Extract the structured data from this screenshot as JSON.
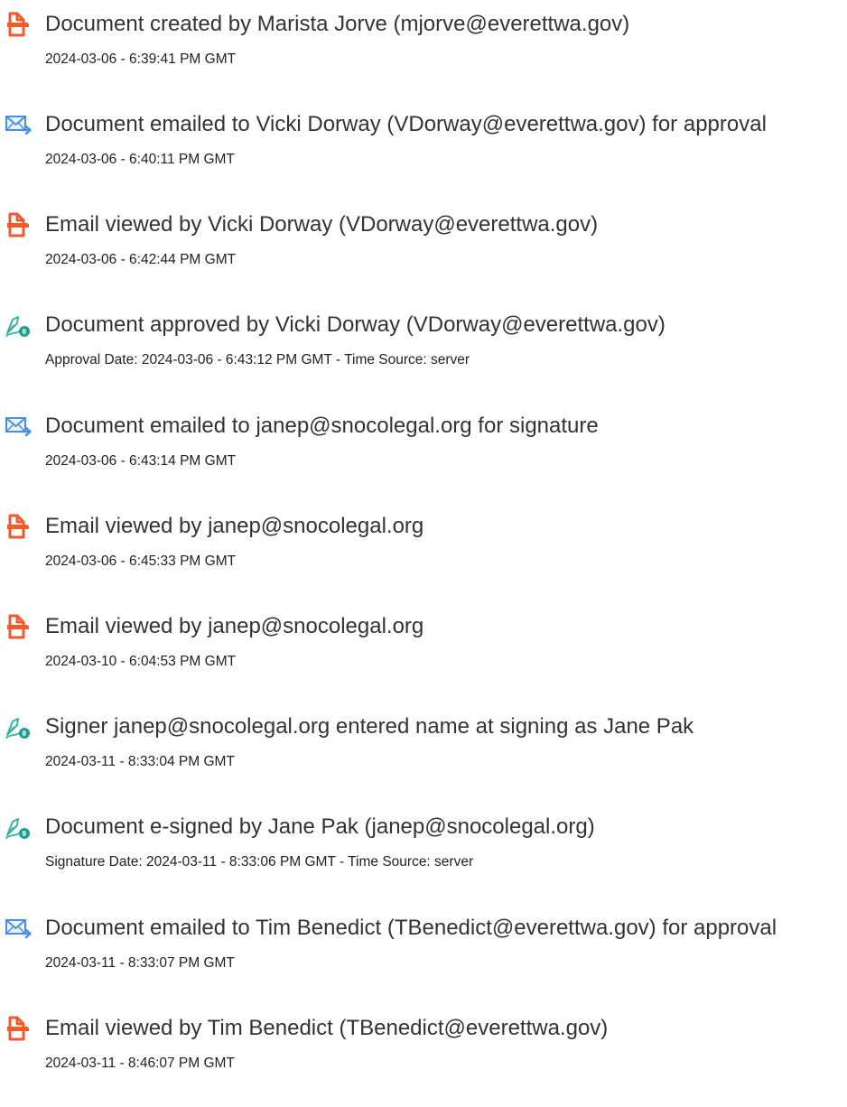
{
  "colors": {
    "created_icon": "#f15a2b",
    "email_icon": "#4a90e2",
    "sign_icon_pen": "#3bb3a4",
    "sign_icon_badge": "#1aa08f",
    "text": "#333333"
  },
  "events": [
    {
      "icon": "document-created-icon",
      "description": "Document created by Marista Jorve (mjorve@everettwa.gov)",
      "timestamp": "2024-03-06 - 6:39:41 PM GMT"
    },
    {
      "icon": "email-sent-icon",
      "description": "Document emailed to Vicki Dorway (VDorway@everettwa.gov) for approval",
      "timestamp": "2024-03-06 - 6:40:11 PM GMT"
    },
    {
      "icon": "document-viewed-icon",
      "description": "Email viewed by Vicki Dorway (VDorway@everettwa.gov)",
      "timestamp": "2024-03-06 - 6:42:44 PM GMT"
    },
    {
      "icon": "e-sign-icon",
      "description": "Document approved by Vicki Dorway (VDorway@everettwa.gov)",
      "timestamp": "Approval Date: 2024-03-06 - 6:43:12 PM GMT - Time Source: server"
    },
    {
      "icon": "email-sent-icon",
      "description": "Document emailed to janep@snocolegal.org for signature",
      "timestamp": "2024-03-06 - 6:43:14 PM GMT"
    },
    {
      "icon": "document-viewed-icon",
      "description": "Email viewed by janep@snocolegal.org",
      "timestamp": "2024-03-06 - 6:45:33 PM GMT"
    },
    {
      "icon": "document-viewed-icon",
      "description": "Email viewed by janep@snocolegal.org",
      "timestamp": "2024-03-10 - 6:04:53 PM GMT"
    },
    {
      "icon": "e-sign-icon",
      "description": "Signer janep@snocolegal.org entered name at signing as Jane Pak",
      "timestamp": "2024-03-11 - 8:33:04 PM GMT"
    },
    {
      "icon": "e-sign-icon",
      "description": "Document e-signed by Jane Pak (janep@snocolegal.org)",
      "timestamp": "Signature Date: 2024-03-11 - 8:33:06 PM GMT - Time Source: server"
    },
    {
      "icon": "email-sent-icon",
      "description": "Document emailed to Tim Benedict (TBenedict@everettwa.gov) for approval",
      "timestamp": "2024-03-11 - 8:33:07 PM GMT"
    },
    {
      "icon": "document-viewed-icon",
      "description": "Email viewed by Tim Benedict (TBenedict@everettwa.gov)",
      "timestamp": "2024-03-11 - 8:46:07 PM GMT"
    }
  ]
}
